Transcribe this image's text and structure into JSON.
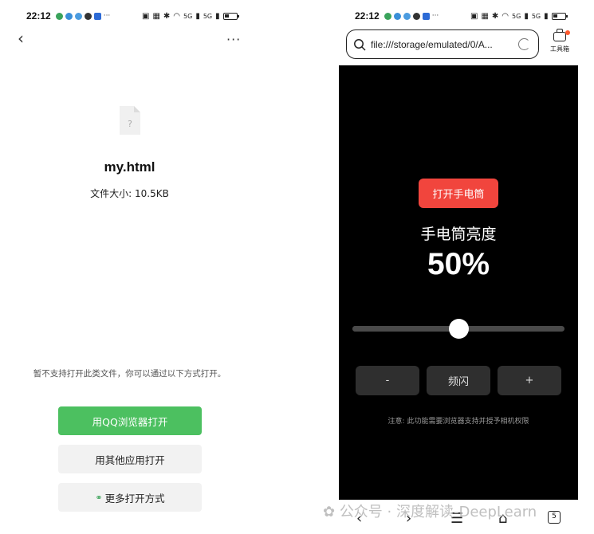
{
  "left_screen": {
    "status_bar": {
      "time": "22:12",
      "network": "5G",
      "signal": "5G"
    },
    "file": {
      "name": "my.html",
      "size": "文件大小: 10.5KB",
      "icon_glyph": "?"
    },
    "notice": "暂不支持打开此类文件，你可以通过以下方式打开。",
    "buttons": {
      "qq_browser": "用QQ浏览器打开",
      "other_apps": "用其他应用打开",
      "more_ways": "更多打开方式"
    }
  },
  "right_screen": {
    "status_bar": {
      "time": "22:12",
      "network": "5G",
      "signal": "5G"
    },
    "address_bar": {
      "url": "file:///storage/emulated/0/A..."
    },
    "toolbox_label": "工具箱",
    "flashlight_app": {
      "toggle_button": "打开手电筒",
      "brightness_title": "手电筒亮度",
      "brightness_value": "50%",
      "brightness_fraction": 0.5,
      "minus_button": "-",
      "strobe_button": "频闪",
      "plus_button": "+",
      "note": "注意: 此功能需要浏览器支持并授予相机权限"
    },
    "nav": {
      "tab_count": "5"
    }
  },
  "watermark": "公众号 · 深度解读-DeepLearn",
  "colors": {
    "green": "#4cc060",
    "red": "#f1453d",
    "dark": "#000000",
    "toolbox_dot": "#ff5a2e"
  }
}
